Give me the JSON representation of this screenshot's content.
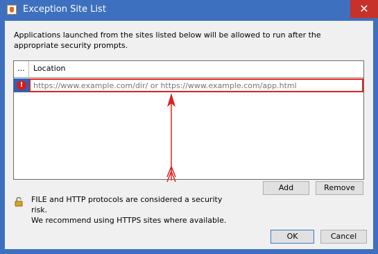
{
  "window": {
    "title": "Exception Site List",
    "close_glyph": "✕"
  },
  "message": "Applications launched from the sites listed below will be allowed to run after the appropriate security prompts.",
  "table": {
    "col_ellipsis": "...",
    "col_location": "Location",
    "row_error_glyph": "!",
    "location_placeholder": "https://www.example.com/dir/ or https://www.example.com/app.html"
  },
  "buttons": {
    "add": "Add",
    "remove": "Remove",
    "ok": "OK",
    "cancel": "Cancel"
  },
  "warning": {
    "line1": "FILE and HTTP protocols are considered a security risk.",
    "line2": "We recommend using HTTPS sites where available."
  },
  "icons": {
    "title": "java-icon",
    "error": "error-icon",
    "lock": "unlocked-padlock-icon"
  },
  "colors": {
    "title_bar": "#3d70be",
    "close": "#c8302a",
    "highlight": "#e02020",
    "selection": "#2d63b8"
  }
}
